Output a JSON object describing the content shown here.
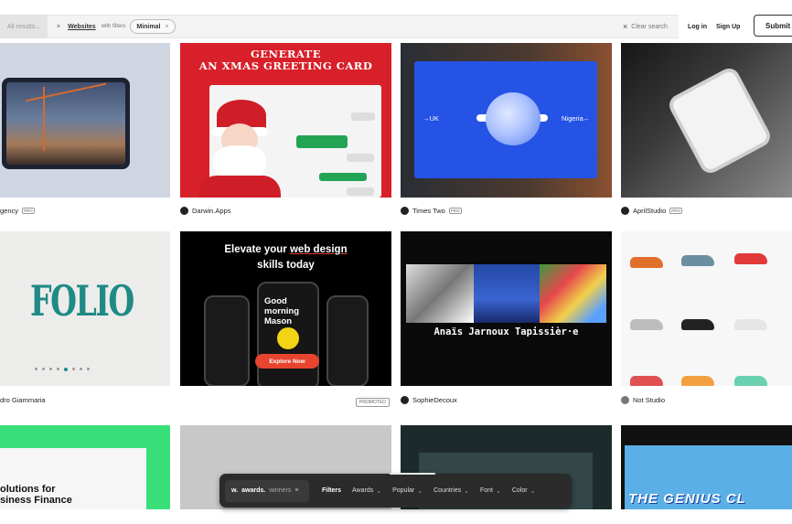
{
  "search": {
    "all_results": "All results...",
    "close_glyph": "×",
    "tag": "Websites",
    "with_filters": "with filters",
    "chip": "Minimal",
    "chip_remove": "×",
    "clear": "Clear search"
  },
  "auth": {
    "login": "Log in",
    "signup": "Sign Up",
    "submit": "Submit"
  },
  "cards": [
    {
      "label": "gency",
      "pro": "PRO"
    },
    {
      "label": "Darwin.Apps",
      "title": "GENERATE\nAN XMAS GREETING CARD"
    },
    {
      "label": "Times Two",
      "pro": "PRO",
      "left_text": "→UK",
      "right_text": "Nigeria←"
    },
    {
      "label": "AprilStudio",
      "pro": "PRO"
    },
    {
      "label": "dro Giammaria",
      "logo_text": "FOLIO"
    },
    {
      "badge": "PROMOTED",
      "headline_pre": "Elevate your ",
      "headline_em": "web design",
      "headline_post": "skills today",
      "phone_text": "Good morning Mason",
      "cta": "Explore Now"
    },
    {
      "label": "SophieDecoux",
      "name": "Anaïs Jarnoux Tapissièr·e"
    },
    {
      "label": "Not Studio"
    },
    {
      "headline": "olutions for\nsiness Finance"
    },
    {},
    {},
    {
      "title": "THE GENIUS CL"
    }
  ],
  "filterbar": {
    "brand_w": "w.",
    "brand_awards": "awards.",
    "brand_winners": "winners",
    "filters": "Filters",
    "items": [
      "Awards",
      "Popular",
      "Countries",
      "Font",
      "Color"
    ]
  },
  "colors": {
    "accent_red": "#d8202a",
    "accent_green": "#39e07a",
    "accent_blue": "#2553e6"
  }
}
